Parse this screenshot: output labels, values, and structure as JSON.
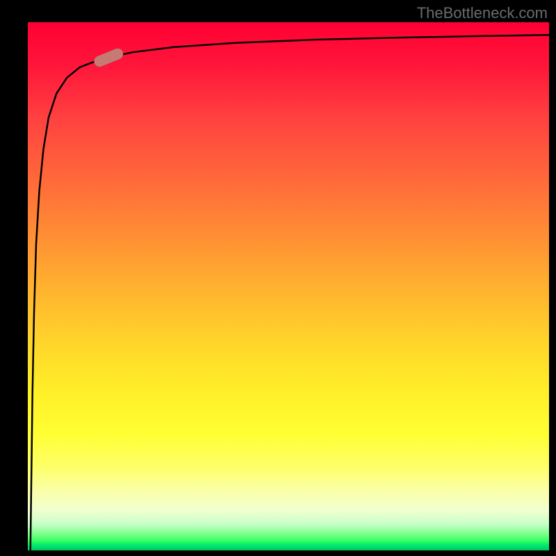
{
  "watermark": "TheBottleneck.com",
  "colors": {
    "background": "#000000",
    "watermark_text": "#6b6b6b",
    "curve": "#000000",
    "marker": "#c77a74"
  },
  "chart_data": {
    "type": "line",
    "title": "",
    "xlabel": "",
    "ylabel": "",
    "xlim": [
      0,
      100
    ],
    "ylim": [
      0,
      100
    ],
    "grid": false,
    "series": [
      {
        "name": "bottleneck-curve",
        "x": [
          0.5,
          0.7,
          0.9,
          1.2,
          1.6,
          2.2,
          3.0,
          4.0,
          5.5,
          7.5,
          10,
          14,
          20,
          28,
          40,
          55,
          72,
          88,
          100
        ],
        "values": [
          0,
          15,
          30,
          45,
          58,
          68,
          76,
          82,
          86.5,
          89.5,
          91.5,
          93,
          94.3,
          95.3,
          96.1,
          96.7,
          97.1,
          97.4,
          97.6
        ]
      }
    ],
    "marker": {
      "x": 15.5,
      "y": 93.3,
      "angle_deg": 22
    },
    "background_gradient": {
      "direction": "vertical",
      "stops": [
        {
          "pos": 0.0,
          "color": "#ff0033"
        },
        {
          "pos": 0.3,
          "color": "#ff6a3a"
        },
        {
          "pos": 0.62,
          "color": "#ffd92a"
        },
        {
          "pos": 0.84,
          "color": "#feff66"
        },
        {
          "pos": 0.95,
          "color": "#c8ffc8"
        },
        {
          "pos": 1.0,
          "color": "#00c853"
        }
      ]
    }
  }
}
